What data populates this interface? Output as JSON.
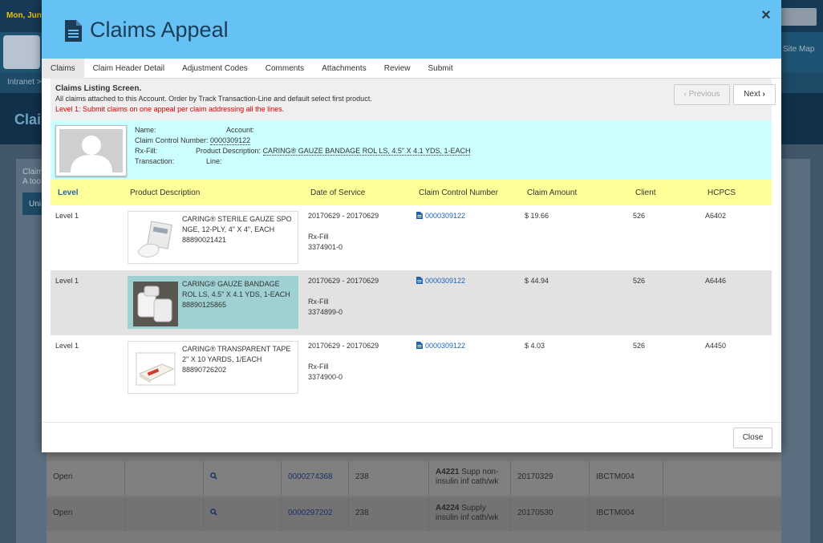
{
  "background": {
    "date": "Mon, Jun.",
    "site_map": "Site Map",
    "breadcrumb": "Intranet >",
    "page_title": "Clai",
    "claim_text_1": "Claim",
    "claim_text_2": "A too",
    "side_button": "Uni",
    "rows": [
      {
        "status": "Open",
        "ccn": "0000274368",
        "n": "238",
        "code": "A4221",
        "desc": "Supp non-insulin inf cath/wk",
        "date": "20170329",
        "id": "IBCTM004"
      },
      {
        "status": "Open",
        "ccn": "0000297202",
        "n": "238",
        "code": "A4224",
        "desc": "Supply insulin inf cath/wk",
        "date": "20170530",
        "id": "IBCTM004"
      }
    ]
  },
  "modal": {
    "title": "Claims Appeal",
    "tabs": [
      "Claims",
      "Claim Header Detail",
      "Adjustment Codes",
      "Comments",
      "Attachments",
      "Review",
      "Submit"
    ],
    "listing": {
      "title": "Claims Listing Screen.",
      "description": "All claims attached to this Account. Order by Track Transaction-Line and default select first product.",
      "warning": "Level 1: Submit claims on one appeal per claim addressing all the lines."
    },
    "prev_label": "Previous",
    "next_label": "Next",
    "info": {
      "name_label": "Name:",
      "account_label": "Account:",
      "ccn_label": "Claim Control Number:",
      "ccn_value": "0000309122",
      "rxfill_label": "Rx-Fill:",
      "product_label": "Product Description:",
      "product_value": "CARING® GAUZE BANDAGE ROL LS, 4.5\" X 4.1 YDS, 1-EACH",
      "transaction_label": "Transaction:",
      "line_label": "Line:"
    },
    "columns": [
      "Level",
      "Product Description",
      "Date of Service",
      "Claim Control Number",
      "Claim Amount",
      "Client",
      "HCPCS"
    ],
    "rows": [
      {
        "level": "Level 1",
        "product_line1": "CARING® STERILE GAUZE SPO",
        "product_line2": "NGE, 12-PLY, 4\" X 4\", EACH",
        "product_line3": "88890021421",
        "dos": "20170629 - 20170629",
        "rxfill_label": "Rx-Fill",
        "rxfill": "3374901-0",
        "ccn": "0000309122",
        "amount": "$ 19.66",
        "client": "526",
        "hcpcs": "A6402"
      },
      {
        "level": "Level 1",
        "product_line1": "CARING® GAUZE BANDAGE",
        "product_line2": "ROL LS, 4.5\" X 4.1 YDS, 1-EACH",
        "product_line3": "88890125865",
        "dos": "20170629 - 20170629",
        "rxfill_label": "Rx-Fill",
        "rxfill": "3374899-0",
        "ccn": "0000309122",
        "amount": "$ 44.94",
        "client": "526",
        "hcpcs": "A6446"
      },
      {
        "level": "Level 1",
        "product_line1": "CARING® TRANSPARENT TAPE",
        "product_line2": "2\" X 10 YARDS, 1/EACH",
        "product_line3": "88890726202",
        "dos": "20170629 - 20170629",
        "rxfill_label": "Rx-Fill",
        "rxfill": "3374900-0",
        "ccn": "0000309122",
        "amount": "$ 4.03",
        "client": "526",
        "hcpcs": "A4450"
      }
    ],
    "close_label": "Close",
    "close_icon": "×"
  },
  "colors": {
    "header": "#66c2f5",
    "info_box": "#ccffff",
    "grid_header": "#ffff99",
    "selected_product": "#9fd0d2",
    "warning": "#d40000",
    "link": "#1f63b5"
  }
}
